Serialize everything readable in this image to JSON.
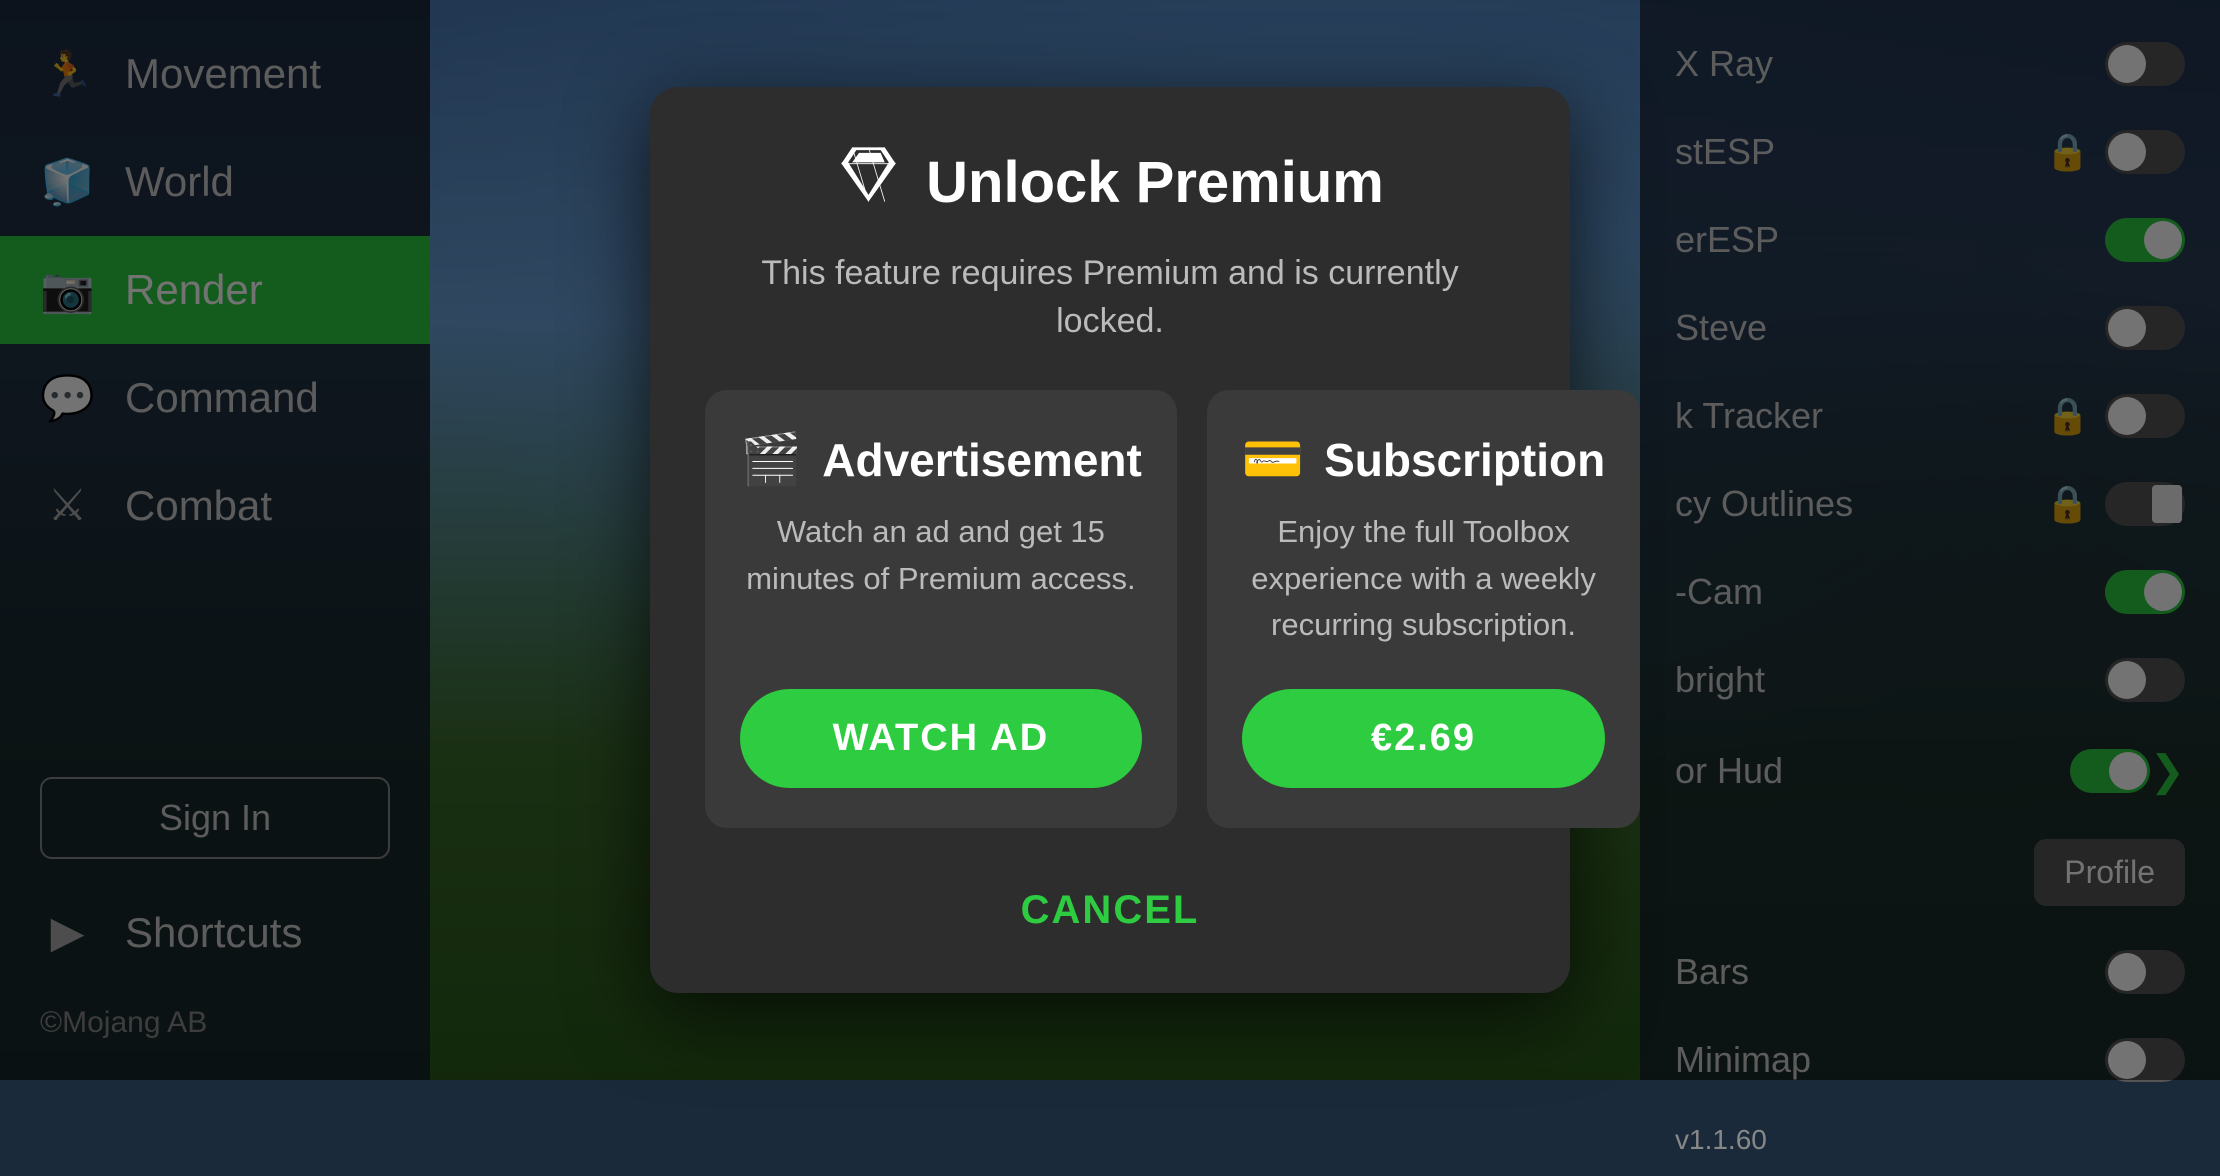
{
  "sidebar": {
    "items": [
      {
        "id": "movement",
        "label": "Movement",
        "icon": "🏃",
        "active": false
      },
      {
        "id": "world",
        "label": "World",
        "icon": "🧊",
        "active": false
      },
      {
        "id": "render",
        "label": "Render",
        "icon": "📷",
        "active": true
      },
      {
        "id": "command",
        "label": "Command",
        "icon": "💬",
        "active": false
      },
      {
        "id": "combat",
        "label": "Combat",
        "icon": "⚔",
        "active": false
      }
    ],
    "sign_in_label": "Sign In",
    "shortcuts_label": "Shortcuts",
    "shortcuts_icon": "▶",
    "copyright": "©Mojang AB"
  },
  "right_panel": {
    "items": [
      {
        "name": "X Ray",
        "locked": false,
        "toggle": "off",
        "has_lock": false
      },
      {
        "name": "stESP",
        "locked": true,
        "toggle": "off",
        "has_lock": true
      },
      {
        "name": "erESP",
        "locked": false,
        "toggle": "on",
        "has_lock": false
      },
      {
        "name": "Steve",
        "locked": false,
        "toggle": "off",
        "has_lock": false
      },
      {
        "name": "k Tracker",
        "locked": true,
        "toggle": "off",
        "has_lock": true
      },
      {
        "name": "cy Outlines",
        "locked": true,
        "toggle": "off",
        "has_lock": true
      },
      {
        "name": "-Cam",
        "locked": false,
        "toggle": "on",
        "has_lock": false
      },
      {
        "name": "bright",
        "locked": false,
        "toggle": "off",
        "has_lock": false
      },
      {
        "name": "or Hud",
        "locked": false,
        "toggle": "chevron",
        "has_lock": false
      },
      {
        "name": "Bars",
        "locked": false,
        "toggle": "off",
        "has_lock": false
      },
      {
        "name": "Minimap",
        "locked": false,
        "toggle": "off",
        "has_lock": false
      }
    ],
    "profile_button": "Profile",
    "version": "v1.1.60"
  },
  "modal": {
    "title": "Unlock Premium",
    "diamond_symbol": "◆",
    "subtitle": "This feature requires Premium and is currently locked.",
    "ad_card": {
      "title": "Advertisement",
      "icon": "🎬",
      "description": "Watch an ad and get 15 minutes of Premium access.",
      "button_label": "WATCH AD"
    },
    "sub_card": {
      "title": "Subscription",
      "icon": "💳",
      "description": "Enjoy the full Toolbox experience with a weekly recurring subscription.",
      "button_label": "€2.69"
    },
    "cancel_label": "CANCEL"
  }
}
